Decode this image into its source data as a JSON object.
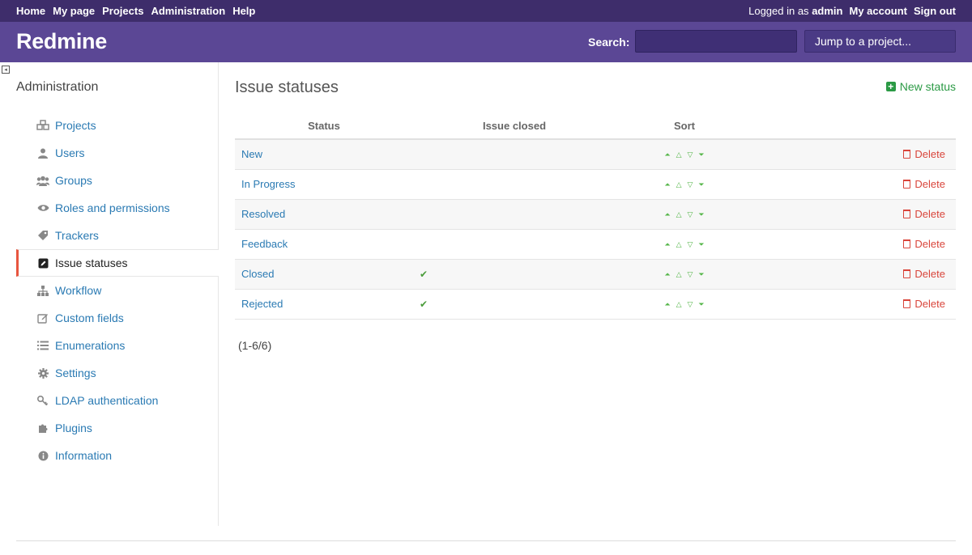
{
  "top_menu": {
    "items": [
      "Home",
      "My page",
      "Projects",
      "Administration",
      "Help"
    ],
    "logged_in_prefix": "Logged in as",
    "user": "admin",
    "my_account": "My account",
    "sign_out": "Sign out"
  },
  "header": {
    "title": "Redmine",
    "search_label": "Search:",
    "search_value": "",
    "jump_label": "Jump to a project..."
  },
  "sidebar": {
    "title": "Administration",
    "items": [
      {
        "label": "Projects",
        "icon": "projects-icon"
      },
      {
        "label": "Users",
        "icon": "user-icon"
      },
      {
        "label": "Groups",
        "icon": "group-icon"
      },
      {
        "label": "Roles and permissions",
        "icon": "eye-icon"
      },
      {
        "label": "Trackers",
        "icon": "tag-icon"
      },
      {
        "label": "Issue statuses",
        "icon": "edit-square-icon",
        "selected": true
      },
      {
        "label": "Workflow",
        "icon": "sitemap-icon"
      },
      {
        "label": "Custom fields",
        "icon": "pencil-icon"
      },
      {
        "label": "Enumerations",
        "icon": "list-icon"
      },
      {
        "label": "Settings",
        "icon": "gear-icon"
      },
      {
        "label": "LDAP authentication",
        "icon": "key-icon"
      },
      {
        "label": "Plugins",
        "icon": "puzzle-icon"
      },
      {
        "label": "Information",
        "icon": "info-icon"
      }
    ]
  },
  "main": {
    "title": "Issue statuses",
    "new_status_label": "New status",
    "columns": [
      "Status",
      "Issue closed",
      "Sort"
    ],
    "delete_label": "Delete",
    "rows": [
      {
        "name": "New",
        "closed": false
      },
      {
        "name": "In Progress",
        "closed": false
      },
      {
        "name": "Resolved",
        "closed": false
      },
      {
        "name": "Feedback",
        "closed": false
      },
      {
        "name": "Closed",
        "closed": true
      },
      {
        "name": "Rejected",
        "closed": true
      }
    ],
    "pagination": "(1-6/6)"
  },
  "colors": {
    "top_bar": "#3e2d6b",
    "header": "#5b4795",
    "link": "#2a7ab3",
    "delete": "#d9453b",
    "accent_green": "#2b9a45",
    "selected_marker": "#e8553f"
  }
}
